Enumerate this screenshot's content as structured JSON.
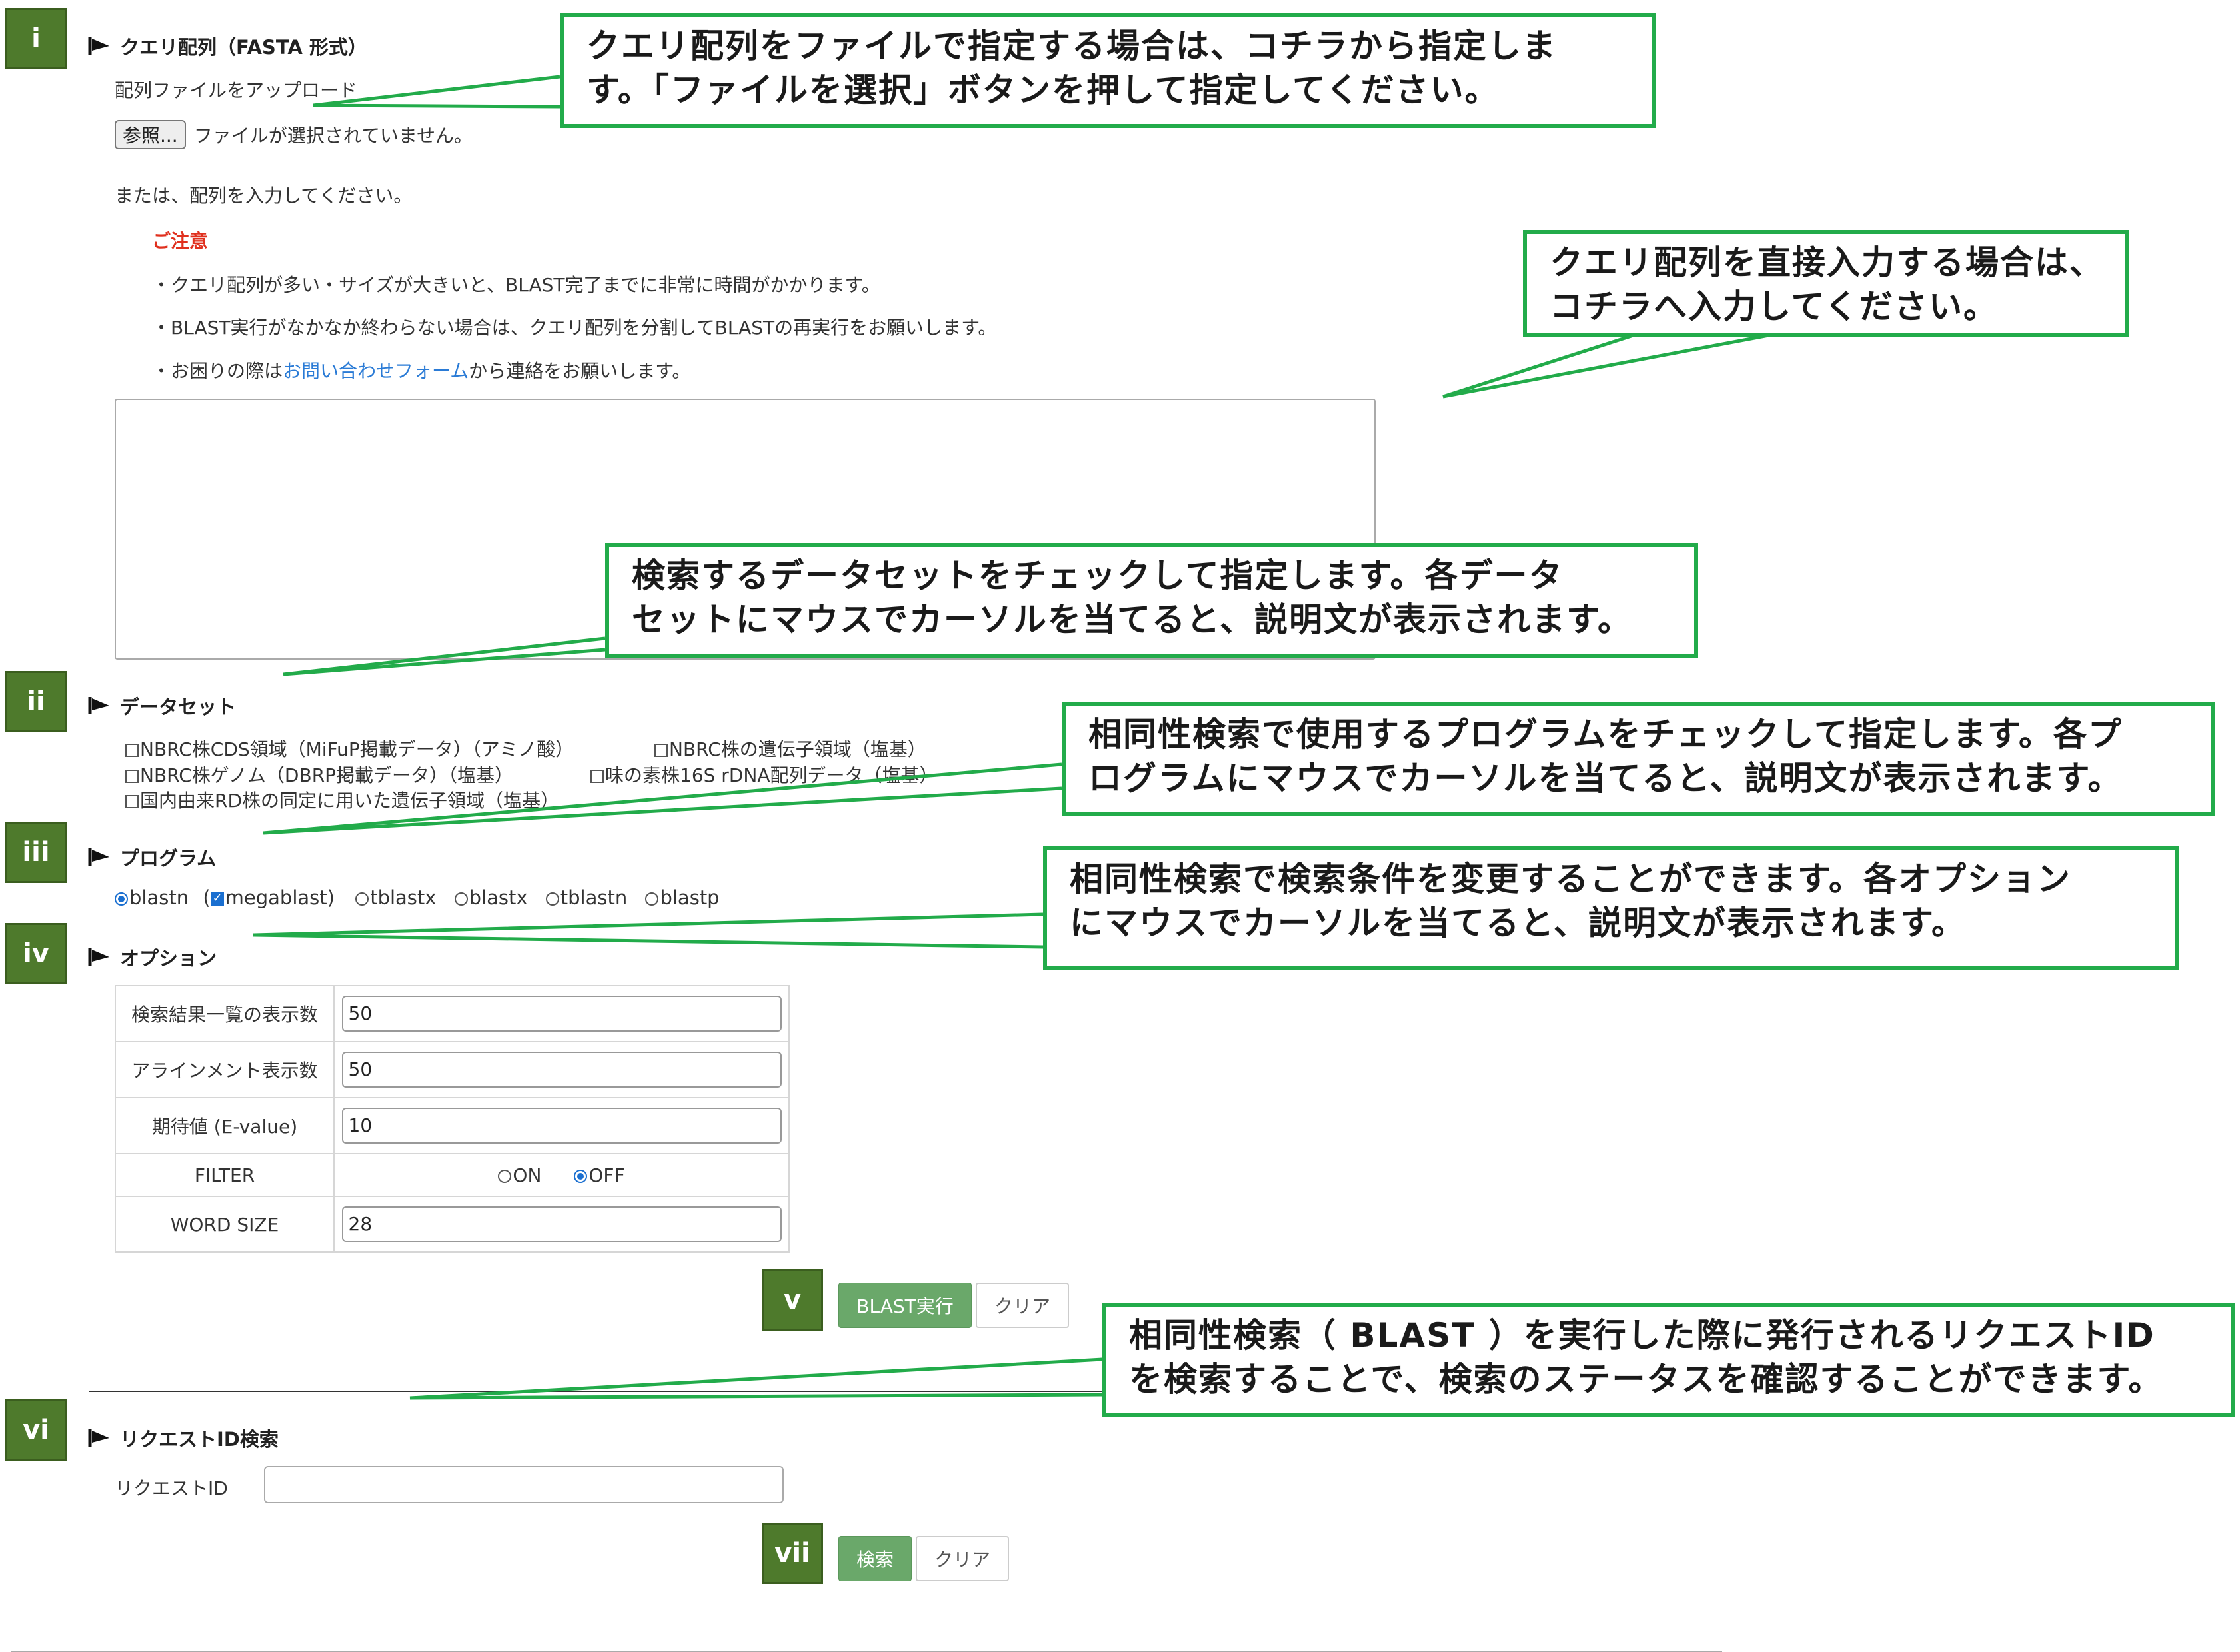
{
  "badges": [
    "i",
    "ii",
    "iii",
    "iv",
    "v",
    "vi",
    "vii"
  ],
  "query": {
    "heading": "クエリ配列（FASTA 形式）",
    "upload_label": "配列ファイルをアップロード",
    "browse_button": "参照...",
    "no_file": "ファイルが選択されていません。",
    "or_enter": "または、配列を入力してください。",
    "caution_title": "ご注意",
    "notes": [
      "・クエリ配列が多い・サイズが大きいと、BLAST完了までに非常に時間がかかります。",
      "・BLAST実行がなかなか終わらない場合は、クエリ配列を分割してBLASTの再実行をお願いします。"
    ],
    "note3_prefix": "・お困りの際は",
    "note3_link": "お問い合わせフォーム",
    "note3_suffix": "から連絡をお願いします。",
    "textarea_value": ""
  },
  "dataset": {
    "heading": "データセット",
    "items": [
      "NBRC株CDS領域（MiFuP掲載データ）（アミノ酸）",
      "NBRC株の遺伝子領域（塩基）",
      "NBRC株ゲノム（DBRP掲載データ）（塩基）",
      "味の素株16S rDNA配列データ（塩基）",
      "国内由来RD株の同定に用いた遺伝子領域（塩基）"
    ]
  },
  "program": {
    "heading": "プログラム",
    "blastn": "blastn",
    "megablast": "megablast",
    "paren_open": "(",
    "paren_close": ")",
    "others": [
      "tblastx",
      "blastx",
      "tblastn",
      "blastp"
    ]
  },
  "options": {
    "heading": "オプション",
    "rows": [
      {
        "label": "検索結果一覧の表示数",
        "value": "50"
      },
      {
        "label": "アラインメント表示数",
        "value": "50"
      },
      {
        "label": "期待値 (E-value)",
        "value": "10"
      }
    ],
    "filter_label": "FILTER",
    "filter_on": "ON",
    "filter_off": "OFF",
    "filter_selected": "OFF",
    "wordsize_label": "WORD SIZE",
    "wordsize_value": "28"
  },
  "actions": {
    "run": "BLAST実行",
    "clear": "クリア"
  },
  "request": {
    "heading": "リクエストID検索",
    "label": "リクエストID",
    "value": "",
    "search": "検索",
    "clear": "クリア"
  },
  "callouts": {
    "c1": [
      "クエリ配列をファイルで指定する場合は、コチラから指定しま",
      "す。「ファイルを選択」ボタンを押して指定してください。"
    ],
    "c2": [
      "クエリ配列を直接入力する場合は、",
      "コチラへ入力してください。"
    ],
    "c3": [
      "検索するデータセットをチェックして指定します。各データ",
      "セットにマウスでカーソルを当てると、説明文が表示されます。"
    ],
    "c4": [
      "相同性検索で使用するプログラムをチェックして指定します。各プ",
      "ログラムにマウスでカーソルを当てると、説明文が表示されます。"
    ],
    "c5": [
      "相同性検索で検索条件を変更することができます。各オプション",
      "にマウスでカーソルを当てると、説明文が表示されます。"
    ],
    "c6": [
      "相同性検索（ BLAST ）を実行した際に発行されるリクエストID",
      "を検索することで、検索のステータスを確認することができます。"
    ]
  },
  "colors": {
    "badge": "#4e7a2c",
    "callout_border": "#22ab4a",
    "button_green": "#6aa86a",
    "caution": "#e0301e",
    "link": "#2a7bd6"
  }
}
